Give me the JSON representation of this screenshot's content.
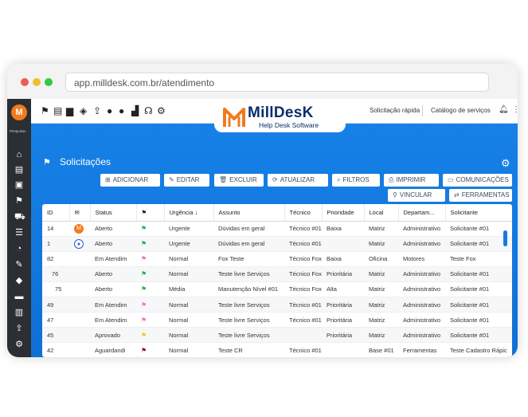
{
  "browser": {
    "url": "app.milldesk.com.br/atendimento",
    "dots": [
      "#ed5d52",
      "#f4bc30",
      "#33c748"
    ]
  },
  "sidebar": {
    "logo_letter": "M",
    "search_label": "Pesquisar...",
    "icons": [
      "home-icon",
      "document-icon",
      "clipboard-icon",
      "flag-icon",
      "cart-icon",
      "list-icon",
      "clock-icon",
      "pencil-icon",
      "tag-icon",
      "briefcase-icon",
      "inbox-icon",
      "upload-icon",
      "settings-icon"
    ]
  },
  "topbar": {
    "icons": [
      "flag-icon",
      "file-plus-icon",
      "id-card-icon",
      "tag-icon",
      "upload-icon",
      "user-icon",
      "user-group-icon",
      "bar-chart-icon",
      "headset-icon",
      "gear-icon"
    ],
    "brand_name": "MillDesK",
    "brand_sub": "Help Desk Software",
    "quick_request": "Solicitação rápida",
    "catalog": "Catálogo de serviços"
  },
  "page": {
    "title": "Solicitações"
  },
  "actions": {
    "add": "ADICIONAR",
    "edit": "EDITAR",
    "delete": "EXCLUIR",
    "refresh": "ATUALIZAR",
    "filters": "FILTROS",
    "print": "IMPRIMIR",
    "communications": "COMUNICAÇÕES",
    "link": "VINCULAR",
    "tools": "FERRAMENTAS"
  },
  "table": {
    "columns": [
      "ID",
      "",
      "Status",
      "",
      "Urgência ↓",
      "Assunto",
      "Técnico",
      "Prioridade",
      "Local",
      "Departam...",
      "Solicitante"
    ],
    "rows": [
      {
        "id": "14",
        "avatar": "M",
        "status": "Aberto",
        "flag": "#22b14c",
        "urgency": "Urgente",
        "subject": "Dúvidas em geral",
        "tech": "Técnico #01",
        "priority": "Baixa",
        "local": "Matriz",
        "dept": "Administrativo",
        "requester": "Solicitante #01"
      },
      {
        "id": "1",
        "avatar": "user",
        "status": "Aberto",
        "flag": "#22b14c",
        "urgency": "Urgente",
        "subject": "Dúvidas em geral",
        "tech": "Técnico #01",
        "priority": "",
        "local": "Matriz",
        "dept": "Administrativo",
        "requester": "Solicitante #01"
      },
      {
        "id": "82",
        "avatar": "",
        "status": "Em Atendim",
        "flag": "#f070c8",
        "urgency": "Normal",
        "subject": "Fox Teste",
        "tech": "Técnico Fox",
        "priority": "Baixa",
        "local": "Oficina",
        "dept": "Motores",
        "requester": "Teste Fox"
      },
      {
        "id": "76",
        "avatar": "",
        "status": "Aberto",
        "flag": "#22b14c",
        "urgency": "Normal",
        "subject": "Teste livre Serviços",
        "tech": "Técnico Fox",
        "priority": "Prioritária",
        "local": "Matriz",
        "dept": "Administrativo",
        "requester": "Solicitante #01"
      },
      {
        "id": "75",
        "avatar": "",
        "status": "Aberto",
        "flag": "#22b14c",
        "urgency": "Média",
        "subject": "Manutenção Nível #01",
        "tech": "Técnico Fox",
        "priority": "Alta",
        "local": "Matriz",
        "dept": "Administrativo",
        "requester": "Solicitante #01"
      },
      {
        "id": "49",
        "avatar": "",
        "status": "Em Atendim",
        "flag": "#f070c8",
        "urgency": "Normal",
        "subject": "Teste livre Serviços",
        "tech": "Técnico #01",
        "priority": "Prioritária",
        "local": "Matriz",
        "dept": "Administrativo",
        "requester": "Solicitante #01"
      },
      {
        "id": "47",
        "avatar": "",
        "status": "Em Atendim",
        "flag": "#f070c8",
        "urgency": "Normal",
        "subject": "Teste livre Serviços",
        "tech": "Técnico #01",
        "priority": "Prioritária",
        "local": "Matriz",
        "dept": "Administrativo",
        "requester": "Solicitante #01"
      },
      {
        "id": "45",
        "avatar": "",
        "status": "Aprovado",
        "flag": "#f5c518",
        "urgency": "Normal",
        "subject": "Teste livre Serviços",
        "tech": "",
        "priority": "Prioritária",
        "local": "Matriz",
        "dept": "Administrativo",
        "requester": "Solicitante #01"
      },
      {
        "id": "42",
        "avatar": "",
        "status": "Aguardandi",
        "flag": "#8b1a1a",
        "urgency": "Normal",
        "subject": "Teste CR",
        "tech": "Técnico #01",
        "priority": "",
        "local": "Base #01",
        "dept": "Ferramentas",
        "requester": "Teste Cadastro Rápic"
      }
    ]
  },
  "colors": {
    "accent": "#1681e8",
    "brand_orange": "#f07b1d",
    "brand_navy": "#0a2d6b",
    "sidebar": "#2b2e33"
  }
}
